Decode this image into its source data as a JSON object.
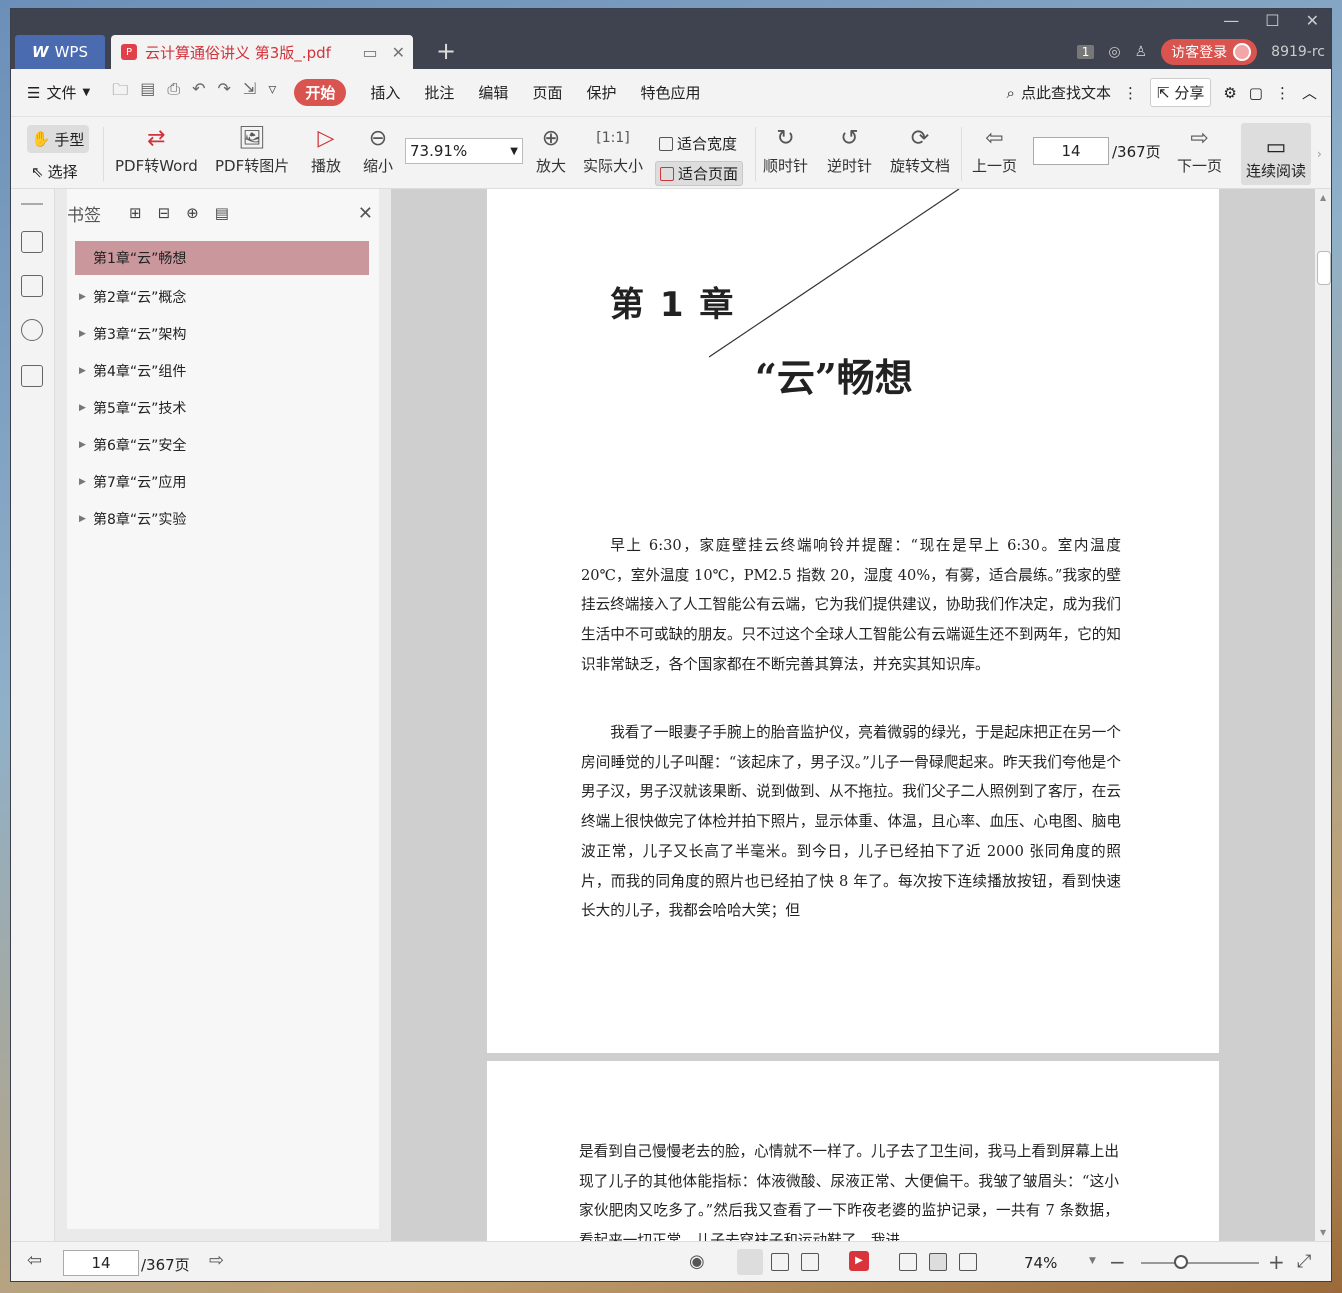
{
  "titlebar": {
    "wps_label": "WPS",
    "doc_tab_title": "云计算通俗讲义 第3版_.pdf",
    "new_tab": "+",
    "badge": "1",
    "login_label": "访客登录",
    "user_code": "8919-rc",
    "win_min": "—",
    "win_max": "☐",
    "win_close": "✕"
  },
  "menubar": {
    "file_label": "文件",
    "items": [
      "开始",
      "插入",
      "批注",
      "编辑",
      "页面",
      "保护",
      "特色应用"
    ],
    "active": "开始",
    "search_label": "点此查找文本",
    "share_label": "分享"
  },
  "toolbar": {
    "hand_label": "手型",
    "select_label": "选择",
    "pdf_to_word": "PDF转Word",
    "pdf_to_image": "PDF转图片",
    "play": "播放",
    "zoom_out": "缩小",
    "zoom_value": "73.91%",
    "zoom_in": "放大",
    "actual_size": "实际大小",
    "fit_width": "适合宽度",
    "fit_page": "适合页面",
    "clockwise": "顺时针",
    "counterclockwise": "逆时针",
    "rotate_doc": "旋转文档",
    "prev_page": "上一页",
    "page_current": "14",
    "page_total": "/367页",
    "next_page": "下一页",
    "continuous_read": "连续阅读"
  },
  "bookmarks": {
    "title": "书签",
    "items": [
      "第1章“云”畅想",
      "第2章“云”概念",
      "第3章“云”架构",
      "第4章“云”组件",
      "第5章“云”技术",
      "第6章“云”安全",
      "第7章“云”应用",
      "第8章“云”实验"
    ]
  },
  "document": {
    "chapter_number": "第 1 章",
    "chapter_title": "“云”畅想",
    "paragraph1": "早上 6:30，家庭壁挂云终端响铃并提醒：“现在是早上 6:30。室内温度 20℃，室外温度 10℃，PM2.5 指数 20，湿度 40%，有雾，适合晨练。”我家的壁挂云终端接入了人工智能公有云端，它为我们提供建议，协助我们作决定，成为我们生活中不可或缺的朋友。只不过这个全球人工智能公有云端诞生还不到两年，它的知识非常缺乏，各个国家都在不断完善其算法，并充实其知识库。",
    "paragraph2": "我看了一眼妻子手腕上的胎音监护仪，亮着微弱的绿光，于是起床把正在另一个房间睡觉的儿子叫醒：“该起床了，男子汉。”儿子一骨碌爬起来。昨天我们夸他是个男子汉，男子汉就该果断、说到做到、从不拖拉。我们父子二人照例到了客厅，在云终端上很快做完了体检并拍下照片，显示体重、体温，且心率、血压、心电图、脑电波正常，儿子又长高了半毫米。到今日，儿子已经拍下了近 2000 张同角度的照片，而我的同角度的照片也已经拍了快 8 年了。每次按下连续播放按钮，看到快速长大的儿子，我都会哈哈大笑；但",
    "paragraph3": "是看到自己慢慢老去的脸，心情就不一样了。儿子去了卫生间，我马上看到屏幕上出现了儿子的其他体能指标：体液微酸、尿液正常、大便偏干。我皱了皱眉头：“这小家伙肥肉又吃多了。”然后我又查看了一下昨夜老婆的监护记录，一共有 7 条数据，看起来一切正常。儿子去穿袜子和运动鞋了，我进"
  },
  "statusbar": {
    "page_current": "14",
    "page_total": "/367页",
    "zoom": "74%"
  },
  "colors": {
    "accent": "#d9534f",
    "titlebar": "#3f4350",
    "wps_tab": "#4a6bb0",
    "bookmark_selected": "#c9979c"
  }
}
